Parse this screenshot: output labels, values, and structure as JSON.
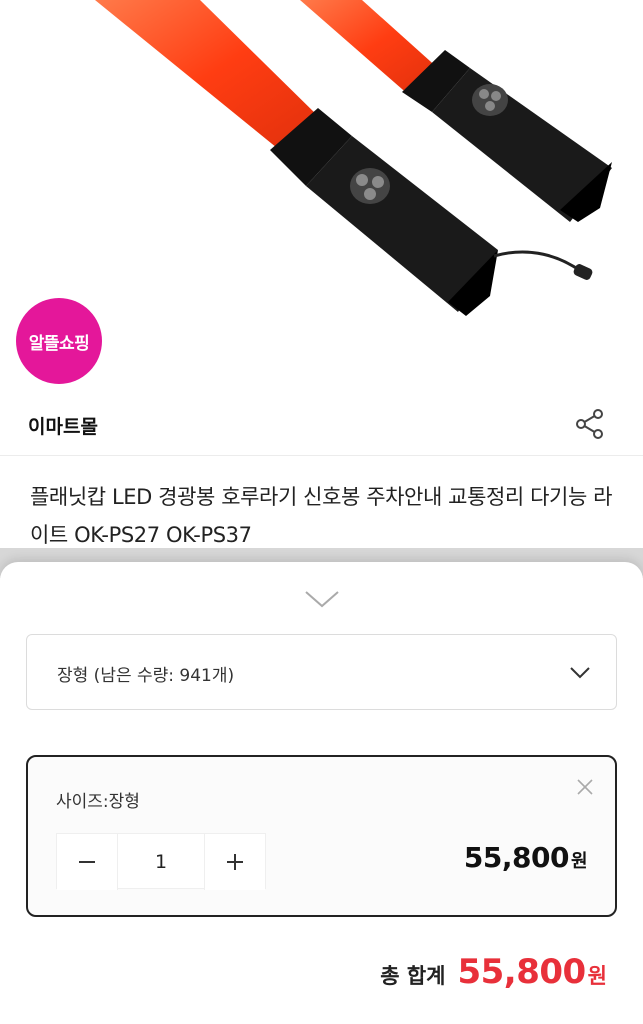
{
  "product": {
    "badge": "알뜰쇼핑",
    "seller": "이마트몰",
    "title": "플래닛캅 LED 경광봉 호루라기 신호봉 주차안내 교통정리 다기능 라이트 OK-PS27 OK-PS37"
  },
  "icons": {
    "share": "share-icon",
    "handle": "chevron-down-icon",
    "select": "chevron-down-icon",
    "remove": "close-icon",
    "minus": "minus-icon",
    "plus": "plus-icon"
  },
  "option_select": {
    "value": "장형 (남은 수량: 941개)"
  },
  "selected_option": {
    "label": "사이즈:장형",
    "quantity": "1",
    "price": "55,800",
    "price_unit": "원"
  },
  "total": {
    "label": "총 합계",
    "price": "55,800",
    "unit": "원"
  },
  "colors": {
    "badge": "#e4179a",
    "total_price": "#e8303a",
    "baton": "#ff4a1c"
  }
}
